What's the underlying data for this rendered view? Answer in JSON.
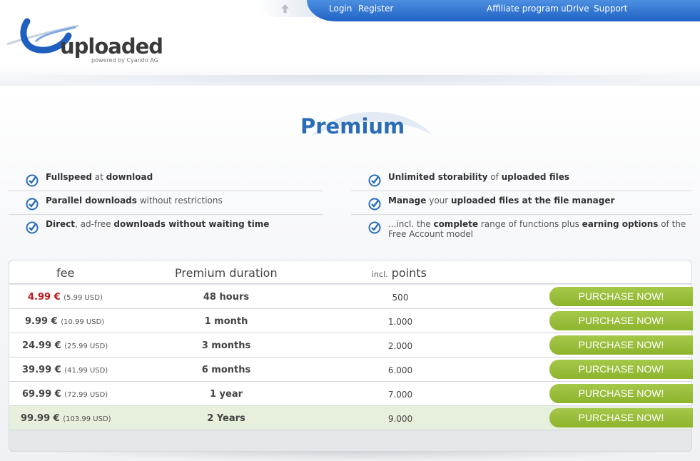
{
  "nav": {
    "login": "Login",
    "register": "Register",
    "affiliate": "Affiliate program",
    "udrive": "uDrive",
    "support": "Support"
  },
  "logo": {
    "word": "uploaded",
    "sub": "powered by Cyando AG"
  },
  "page_title": "Premium",
  "features": {
    "f1": {
      "b1": "Fullspeed",
      "t1": " at ",
      "b2": "download"
    },
    "f2": {
      "b1": "Parallel downloads",
      "t1": " without restrictions"
    },
    "f3": {
      "b1": "Direct",
      "t1": ", ad-free ",
      "b2": "downloads without waiting time"
    },
    "f4": {
      "b1": "Unlimited storability",
      "t1": " of ",
      "b2": "uploaded files"
    },
    "f5": {
      "b1": "Manage",
      "t1": " your ",
      "b2": "uploaded files at the file manager"
    },
    "f6": {
      "t0": "...incl. the ",
      "b1": "complete",
      "t1": " range of functions plus ",
      "b2": "earning options",
      "t2": " of the Free Account model"
    }
  },
  "table": {
    "col_fee": "fee",
    "col_duration": "Premium duration",
    "col_points_prefix": "incl.",
    "col_points": "points",
    "buy_label": "PURCHASE NOW!",
    "rows": [
      {
        "fee": "4.99 €",
        "usd": "(5.99 USD)",
        "duration": "48 hours",
        "points": "500"
      },
      {
        "fee": "9.99 €",
        "usd": "(10.99 USD)",
        "duration": "1 month",
        "points": "1.000"
      },
      {
        "fee": "24.99 €",
        "usd": "(25.99 USD)",
        "duration": "3 months",
        "points": "2.000"
      },
      {
        "fee": "39.99 €",
        "usd": "(41.99 USD)",
        "duration": "6 months",
        "points": "6.000"
      },
      {
        "fee": "69.99 €",
        "usd": "(72.99 USD)",
        "duration": "1 year",
        "points": "7.000"
      },
      {
        "fee": "99.99 €",
        "usd": "(103.99 USD)",
        "duration": "2 Years",
        "points": "9.000"
      }
    ]
  },
  "colors": {
    "nav_blue": "#1f62c4",
    "title_blue": "#2b6cb8",
    "price_red": "#c0171b",
    "button_green": "#99bd3a",
    "highlight_row": "#e6f0dc"
  }
}
